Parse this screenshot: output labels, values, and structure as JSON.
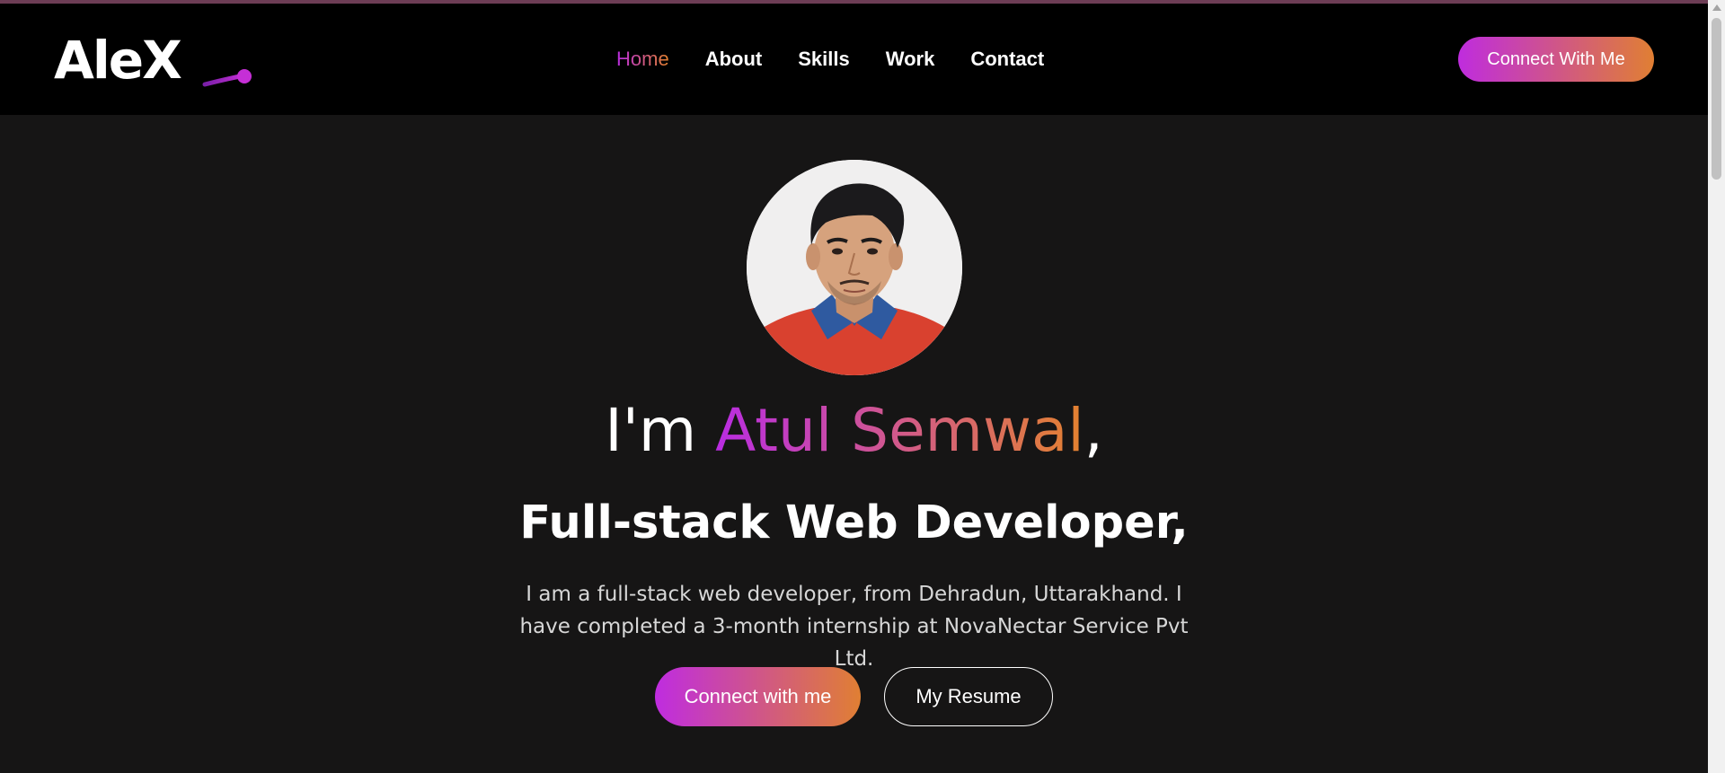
{
  "brand": {
    "logo_text": "AleX",
    "accent_start": "#bf2cde",
    "accent_end": "#e07f33"
  },
  "nav": {
    "items": [
      {
        "label": "Home",
        "active": true
      },
      {
        "label": "About",
        "active": false
      },
      {
        "label": "Skills",
        "active": false
      },
      {
        "label": "Work",
        "active": false
      },
      {
        "label": "Contact",
        "active": false
      }
    ],
    "cta_label": "Connect With Me"
  },
  "hero": {
    "greeting": "I'm ",
    "name": "Atul Semwal",
    "name_suffix": ",",
    "role": "Full-stack Web Developer,",
    "description": "I am a full-stack web developer, from Dehradun, Uttarakhand. I have completed a 3-month internship at NovaNectar Service Pvt Ltd.",
    "primary_button": "Connect with me",
    "secondary_button": "My Resume"
  },
  "icons": {
    "scroll_up": "scroll-up-arrow-icon"
  }
}
